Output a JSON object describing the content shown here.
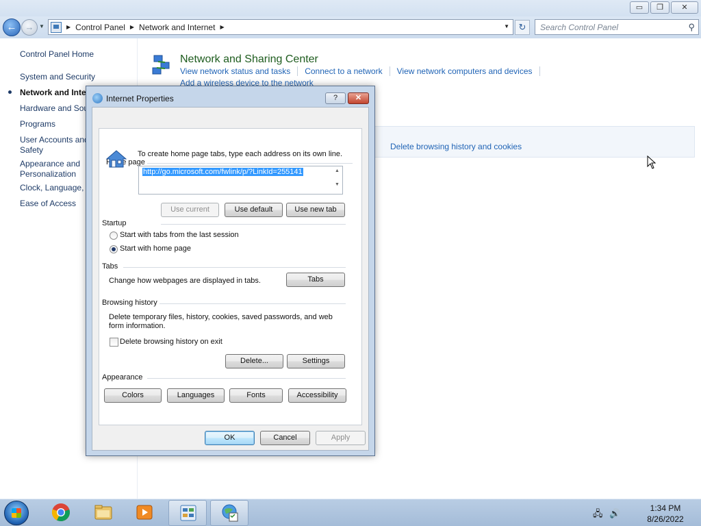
{
  "window": {
    "caption": {
      "minimize": "▭",
      "maximize": "❐",
      "close": "✕"
    },
    "address": {
      "crumbs": [
        "Control Panel",
        "Network and Internet"
      ],
      "search_placeholder": "Search Control Panel"
    },
    "sidebar": {
      "items": [
        "Control Panel Home",
        "System and Security",
        "Network and Inte",
        "Hardware and Sou",
        "Programs",
        "User Accounts and",
        "Safety",
        "Appearance and",
        "Personalization",
        "Clock, Language, a",
        "Ease of Access"
      ]
    },
    "main": {
      "title": "Network and Sharing Center",
      "links": [
        "View network status and tasks",
        "Connect to a network",
        "View network computers and devices"
      ],
      "link_extra": "Add a wireless device to the network",
      "highlight_link": "Delete browsing history and cookies"
    }
  },
  "dialog": {
    "title": "Internet Properties",
    "help": "?",
    "close": "✕",
    "home_page": {
      "label": "Home page",
      "description": "To create home page tabs, type each address on its own line.",
      "url": "http://go.microsoft.com/fwlink/p/?LinkId=255141",
      "use_current": "Use current",
      "use_default": "Use default",
      "use_new_tab": "Use new tab"
    },
    "startup": {
      "label": "Startup",
      "option_last_session": "Start with tabs from the last session",
      "option_home_page": "Start with home page",
      "selected": "Start with home page"
    },
    "tabs": {
      "label": "Tabs",
      "description": "Change how webpages are displayed in tabs.",
      "button": "Tabs"
    },
    "browsing_history": {
      "label": "Browsing history",
      "description_line1": "Delete temporary files, history, cookies, saved passwords, and web",
      "description_line2": "form information.",
      "checkbox_label": "Delete browsing history on exit",
      "checkbox_checked": false,
      "delete_button": "Delete...",
      "settings_button": "Settings"
    },
    "appearance": {
      "label": "Appearance",
      "colors": "Colors",
      "languages": "Languages",
      "fonts": "Fonts",
      "accessibility": "Accessibility"
    },
    "footer": {
      "ok": "OK",
      "cancel": "Cancel",
      "apply": "Apply"
    }
  },
  "taskbar": {
    "time": "1:34 PM",
    "date": "8/26/2022",
    "apps": [
      "start-orb",
      "chrome-icon",
      "file-explorer-icon",
      "media-player-icon",
      "control-panel-icon",
      "internet-options-icon"
    ]
  },
  "colors": {
    "accent_link": "#1f63b5",
    "title_green": "#1e5c1e",
    "selection": "#3399ff"
  }
}
